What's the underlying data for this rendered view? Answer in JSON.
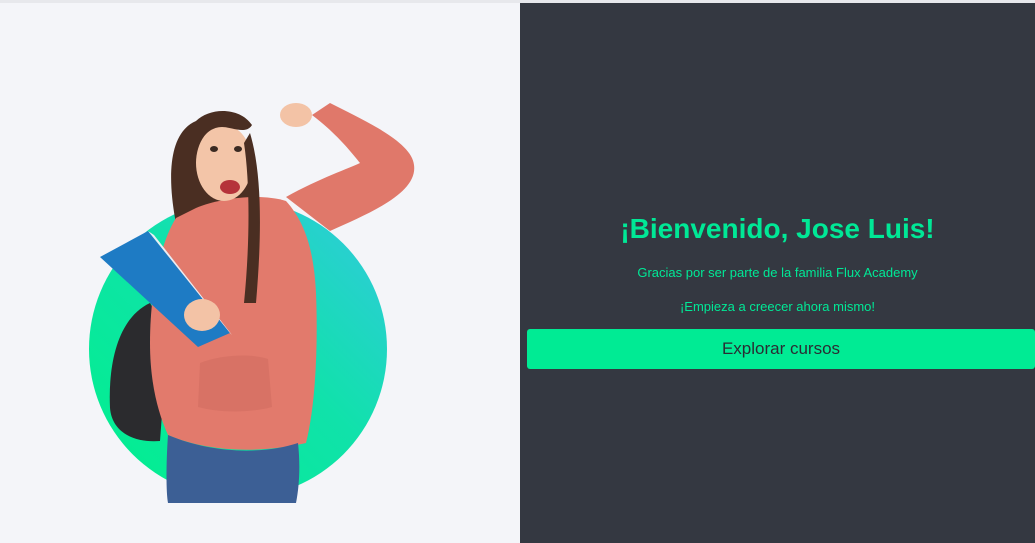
{
  "welcome": {
    "title": "¡Bienvenido, Jose Luis!",
    "subtitle": "Gracias por ser parte de la familia Flux Academy",
    "tagline": "¡Empieza a creecer ahora mismo!",
    "cta_label": "Explorar cursos"
  },
  "colors": {
    "accent": "#00eb94",
    "panel_dark": "#343841",
    "panel_light": "#f4f5f9"
  }
}
